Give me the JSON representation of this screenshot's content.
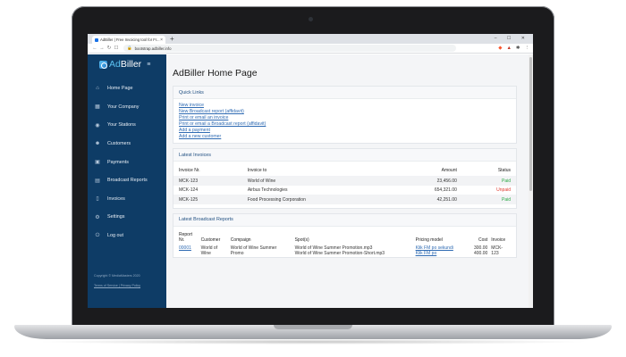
{
  "browser": {
    "tab_title": "AdBiller | Free Invoicing tool for Fr...",
    "tab_close": "×",
    "new_tab": "+",
    "url": "bootstrap.adbiller.info",
    "nav_back": "←",
    "nav_forward": "→",
    "nav_reload": "↻",
    "bookmark": "☐",
    "window_controls": "– ☐ ✕"
  },
  "sidebar": {
    "logo_prefix": "Ad",
    "logo_suffix": "Biller",
    "hamburger": "≡",
    "items": [
      {
        "label": "Home Page",
        "icon": "home-icon",
        "glyph": "⌂"
      },
      {
        "label": "Your Company",
        "icon": "building-icon",
        "glyph": "▦"
      },
      {
        "label": "Your Stations",
        "icon": "broadcast-icon",
        "glyph": "◉"
      },
      {
        "label": "Customers",
        "icon": "users-icon",
        "glyph": "☻"
      },
      {
        "label": "Payments",
        "icon": "payment-icon",
        "glyph": "▣"
      },
      {
        "label": "Broadcast Reports",
        "icon": "report-icon",
        "glyph": "▤"
      },
      {
        "label": "Invoices",
        "icon": "invoice-icon",
        "glyph": "▯"
      },
      {
        "label": "Settings",
        "icon": "gear-icon",
        "glyph": "⚙"
      },
      {
        "label": "Log out",
        "icon": "logout-icon",
        "glyph": "⏻"
      }
    ],
    "copyright": "Copyright © MediaMasters 2020",
    "legal": "Terms of Service | Privacy Policy"
  },
  "main": {
    "title": "AdBiller Home Page",
    "quick_links": {
      "header": "Quick Links",
      "links": [
        "New invoice",
        "New Broadcast report (affidavit)",
        "Print or email an invoice",
        "Print or email a Broadcast report (affidavit)",
        "Add a payment",
        "Add a new customer"
      ]
    },
    "latest_invoices": {
      "header": "Latest Invoices",
      "columns": [
        "Invoice Nr.",
        "Invoice to",
        "Amount",
        "Status"
      ],
      "rows": [
        {
          "nr": "MCK-123",
          "to": "World of Wine",
          "amount": "23,456.00",
          "status": "Paid"
        },
        {
          "nr": "MCK-124",
          "to": "Airbus Technologies",
          "amount": "654,321.00",
          "status": "Unpaid"
        },
        {
          "nr": "MCK-125",
          "to": "Food Processing Corporation",
          "amount": "42,251.00",
          "status": "Paid"
        }
      ]
    },
    "latest_reports": {
      "header": "Latest Broadcast Reports",
      "columns": {
        "report_line1": "Report",
        "report_line2": "Nr.",
        "customer": "Customer",
        "campaign": "Compaign",
        "spots": "Spot(s)",
        "pricing": "Pricing model",
        "cost": "Cost",
        "invoice": "Invoice"
      },
      "rows": [
        {
          "nr": "00001",
          "customer_l1": "World of",
          "customer_l2": "Wine",
          "campaign_l1": "World of Wine Summer",
          "campaign_l2": "Promo",
          "spot1": "World of Wine Summer Promotion.mp3",
          "spot2": "World of Wine Summer Promotion-Short.mp3",
          "pricing1": "Klik FM po sekundi",
          "pricing2": "Klik FM po",
          "cost1": "300.00",
          "cost2": "400.00",
          "invoice_l1": "MCK-",
          "invoice_l2": "123"
        }
      ]
    }
  },
  "colors": {
    "sidebar_bg": "#0e3c66",
    "accent": "#5cc2f2",
    "link": "#2f6bb3",
    "paid": "#2aa845",
    "unpaid": "#e03a2f"
  }
}
